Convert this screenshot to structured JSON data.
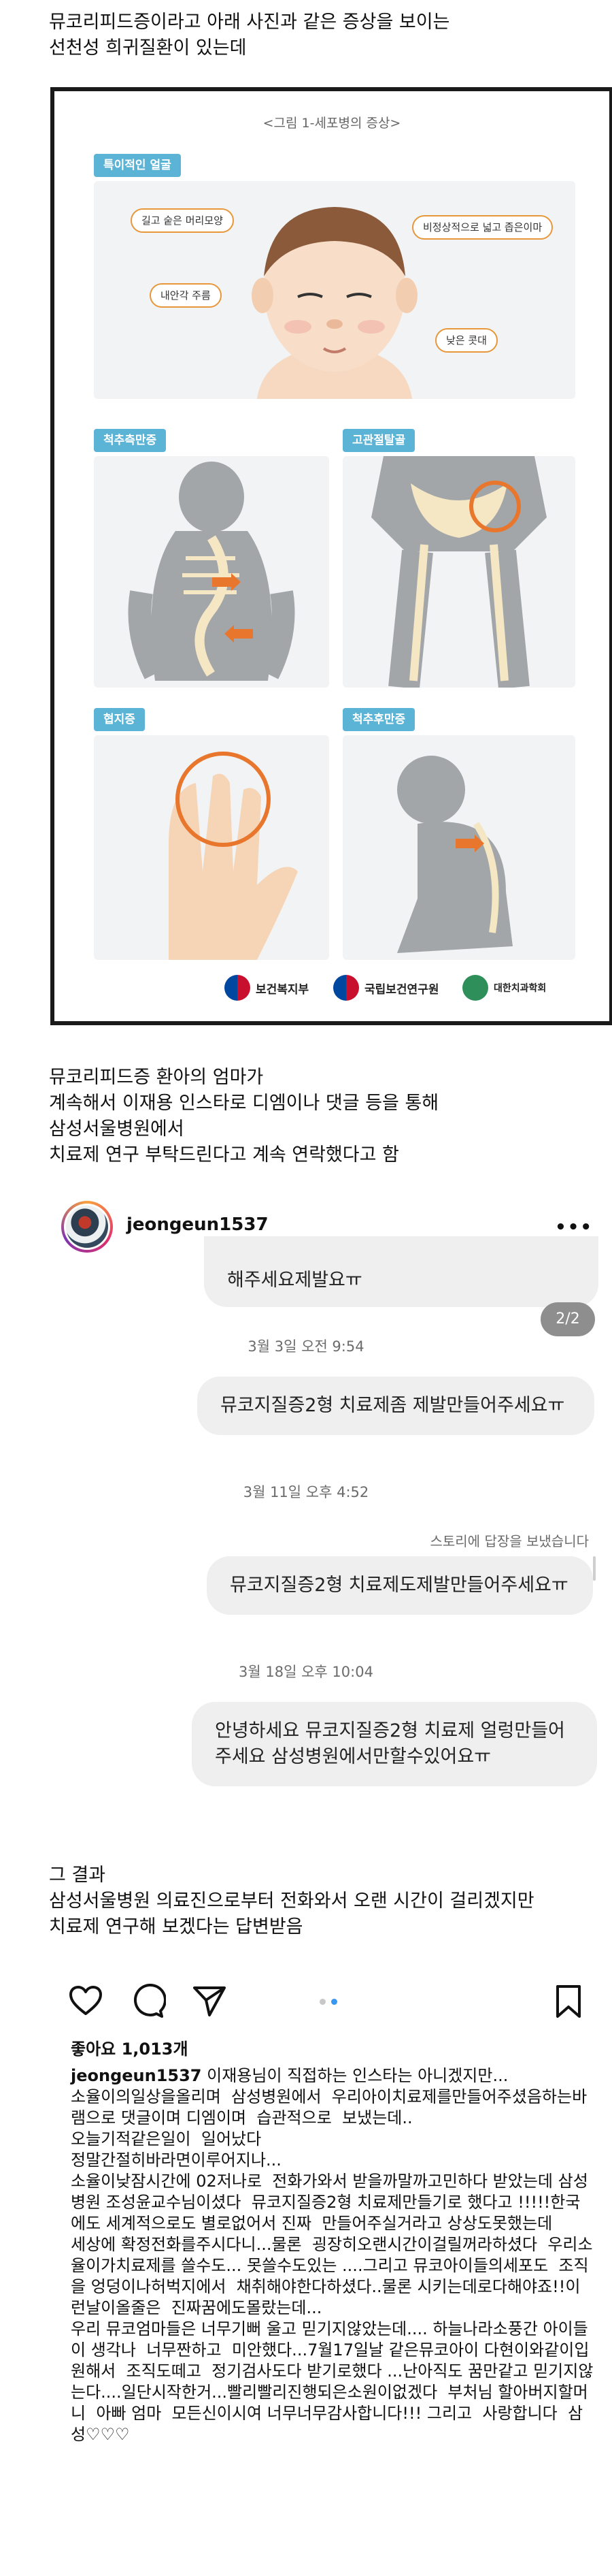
{
  "intro_text": [
    "뮤코리피드증이라고 아래 사진과 같은 증상을 보이는",
    "선천성 희귀질환이 있는데"
  ],
  "infographic": {
    "title": "<그림 1-세포병의 증상>",
    "sections": {
      "face": "특이적인 얼굴",
      "spine": "척추측만증",
      "hip": "고관절탈골",
      "finger": "협지증",
      "kyphosis": "척추후만증"
    },
    "callouts": {
      "hair": "길고 숱은 머리모양",
      "forehead": "비정상적으로 넓고 좁은이마",
      "eyelid": "내안각 주름",
      "nose": "낮은 콧대"
    },
    "logos": [
      "보건복지부",
      "국립보건연구원",
      "대한치과학회"
    ]
  },
  "mid_text": [
    "뮤코리피드증 환아의 엄마가",
    "계속해서 이재용 인스타로 디엠이나 댓글 등을 통해",
    "삼성서울병원에서",
    "치료제 연구 부탁드린다고 계속 연락했다고 함"
  ],
  "post_header": {
    "username": "jeongeun1537",
    "more_icon": "more-horizontal-icon"
  },
  "dm": {
    "partial_bubble": "해주세요제발요ㅠ",
    "page_badge": "2/2",
    "messages": [
      {
        "time": "3월 3일 오전 9:54",
        "text": "뮤코지질증2형 치료제좀 제발만들어주세요ㅠ"
      },
      {
        "time": "3월 11일 오후 4:52",
        "story_reply": "스토리에 답장을 보냈습니다",
        "text": "뮤코지질증2형 치료제도제발만들어주세요ㅠ"
      },
      {
        "time": "3월 18일 오후 10:04",
        "text": "안녕하세요  뮤코지질증2형 치료제 얼렁만들어주세요 삼성병원에서만할수있어요ㅠ"
      }
    ]
  },
  "result_text": [
    "그 결과",
    "삼성서울병원 의료진으로부터 전화와서 오랜 시간이 걸리겠지만",
    "치료제 연구해 보겠다는 답변받음"
  ],
  "actions": {
    "icons": [
      "heart-icon",
      "comment-icon",
      "share-icon",
      "bookmark-icon"
    ]
  },
  "likes": "좋아요 1,013개",
  "caption": {
    "username": "jeongeun1537",
    "text": " 이재용님이 직접하는 인스타는 아니겠지만...\n소율이의일상을올리며  삼성병원에서  우리아이치료제를만들어주셨음하는바램으로 댓글이며 디엠이며  습관적으로  보냈는데..\n오늘기적같은일이  일어났다\n정말간절히바라면이루어지나...\n소율이낮잠시간에 02저나로  전화가와서 받을까말까고민하다 받았는데 삼성병원 조성윤교수님이셨다  뮤코지질증2형 치료제만들기로 했다고 !!!!!한국에도 세계적으로도 별로없어서 진짜  만들어주실거라고 상상도못했는데\n세상에 확정전화를주시다니...물론  굉장히오랜시간이걸릴꺼라하셨다  우리소율이가치료제를 쓸수도... 못쓸수도있는 ....그리고 뮤코아이들의세포도  조직을 엉덩이나허벅지에서  채취해야한다하셨다..물론 시키는데로다해야죠!!이런날이올줄은  진짜꿈에도몰랐는데...\n우리 뮤코엄마들은 너무기뻐 울고 믿기지않았는데.... 하늘나라소풍간 아이들이 생각나  너무짠하고  미안했다...7월17일날 같은뮤코아이 다현이와같이입원해서  조직도떼고  정기검사도다 받기로했다 ...난아직도 꿈만같고 믿기지않는다....일단시작한거...빨리빨리진행되은소원이없겠다  부처님 할아버지할머니  아빠 엄마  모든신이시여 너무너무감사합니다!!! 그리고  사랑합니다  삼성♡♡♡"
  }
}
